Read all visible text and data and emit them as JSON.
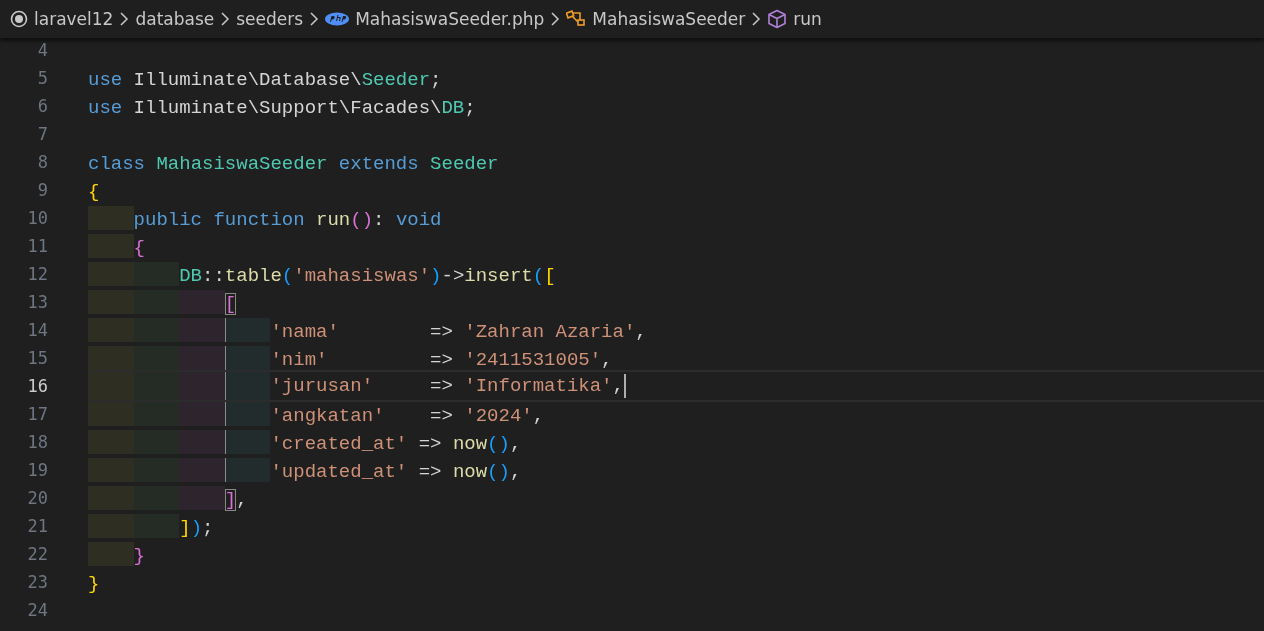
{
  "breadcrumb": [
    {
      "kind": "root",
      "label": "laravel12"
    },
    {
      "kind": "folder",
      "label": "database"
    },
    {
      "kind": "folder",
      "label": "seeders"
    },
    {
      "kind": "php_file",
      "label": "MahasiswaSeeder.php"
    },
    {
      "kind": "class",
      "label": "MahasiswaSeeder"
    },
    {
      "kind": "method",
      "label": "run"
    }
  ],
  "editor": {
    "lines": [
      {
        "number": "4",
        "current": false
      },
      {
        "number": "5",
        "current": false,
        "tokens": [
          {
            "kind": "keyword",
            "text": "use "
          },
          {
            "kind": "plain",
            "text": "Illuminate\\Database\\"
          },
          {
            "kind": "type",
            "text": "Seeder"
          },
          {
            "kind": "plain",
            "text": ";"
          }
        ]
      },
      {
        "number": "6",
        "current": false,
        "tokens": [
          {
            "kind": "keyword",
            "text": "use "
          },
          {
            "kind": "plain",
            "text": "Illuminate\\Support\\Facades\\"
          },
          {
            "kind": "type",
            "text": "DB"
          },
          {
            "kind": "plain",
            "text": ";"
          }
        ]
      },
      {
        "number": "7",
        "current": false
      },
      {
        "number": "8",
        "current": false,
        "tokens": [
          {
            "kind": "keyword",
            "text": "class "
          },
          {
            "kind": "type",
            "text": "MahasiswaSeeder "
          },
          {
            "kind": "keyword",
            "text": "extends "
          },
          {
            "kind": "type",
            "text": "Seeder"
          }
        ]
      },
      {
        "number": "9",
        "current": false,
        "tokens": [
          {
            "kind": "bracket1",
            "text": "{"
          }
        ]
      },
      {
        "number": "10",
        "current": false,
        "tokens": [
          {
            "kind": "keyword",
            "text": "    public function "
          },
          {
            "kind": "function",
            "text": "run"
          },
          {
            "kind": "bracket2",
            "text": "()"
          },
          {
            "kind": "plain",
            "text": ": "
          },
          {
            "kind": "keyword",
            "text": "void"
          }
        ]
      },
      {
        "number": "11",
        "current": false,
        "tokens": [
          {
            "kind": "bracket2",
            "text": "    {"
          }
        ]
      },
      {
        "number": "12",
        "current": false,
        "tokens": [
          {
            "kind": "type",
            "text": "        DB"
          },
          {
            "kind": "plain",
            "text": "::"
          },
          {
            "kind": "function",
            "text": "table"
          },
          {
            "kind": "bracket3",
            "text": "("
          },
          {
            "kind": "string",
            "text": "'mahasiswas'"
          },
          {
            "kind": "bracket3",
            "text": ")"
          },
          {
            "kind": "plain",
            "text": "->"
          },
          {
            "kind": "function",
            "text": "insert"
          },
          {
            "kind": "bracket3",
            "text": "("
          },
          {
            "kind": "bracket1",
            "text": "["
          }
        ]
      },
      {
        "number": "13",
        "current": false,
        "tokens": [
          {
            "kind": "bracket2",
            "text": "            [",
            "matched": true
          }
        ]
      },
      {
        "number": "14",
        "current": false,
        "bracket_guide": true,
        "tokens": [
          {
            "kind": "string",
            "text": "                'nama'"
          },
          {
            "kind": "plain",
            "text": "        => "
          },
          {
            "kind": "string",
            "text": "'Zahran Azaria'"
          },
          {
            "kind": "plain",
            "text": ","
          }
        ]
      },
      {
        "number": "15",
        "current": false,
        "bracket_guide": true,
        "tokens": [
          {
            "kind": "string",
            "text": "                'nim'"
          },
          {
            "kind": "plain",
            "text": "         => "
          },
          {
            "kind": "string",
            "text": "'2411531005'"
          },
          {
            "kind": "plain",
            "text": ","
          }
        ]
      },
      {
        "number": "16",
        "current": true,
        "bracket_guide": true,
        "tokens": [
          {
            "kind": "string",
            "text": "                'jurusan'"
          },
          {
            "kind": "plain",
            "text": "     => "
          },
          {
            "kind": "string",
            "text": "'Informatika'"
          },
          {
            "kind": "plain",
            "text": ","
          }
        ]
      },
      {
        "number": "17",
        "current": false,
        "bracket_guide": true,
        "tokens": [
          {
            "kind": "string",
            "text": "                'angkatan'"
          },
          {
            "kind": "plain",
            "text": "    => "
          },
          {
            "kind": "string",
            "text": "'2024'"
          },
          {
            "kind": "plain",
            "text": ","
          }
        ]
      },
      {
        "number": "18",
        "current": false,
        "bracket_guide": true,
        "tokens": [
          {
            "kind": "string",
            "text": "                'created_at'"
          },
          {
            "kind": "plain",
            "text": " => "
          },
          {
            "kind": "function",
            "text": "now"
          },
          {
            "kind": "bracket3",
            "text": "()"
          },
          {
            "kind": "plain",
            "text": ","
          }
        ]
      },
      {
        "number": "19",
        "current": false,
        "bracket_guide": true,
        "tokens": [
          {
            "kind": "string",
            "text": "                'updated_at'"
          },
          {
            "kind": "plain",
            "text": " => "
          },
          {
            "kind": "function",
            "text": "now"
          },
          {
            "kind": "bracket3",
            "text": "()"
          },
          {
            "kind": "plain",
            "text": ","
          }
        ]
      },
      {
        "number": "20",
        "current": false,
        "tokens": [
          {
            "kind": "bracket2",
            "text": "            ]",
            "matched": true
          },
          {
            "kind": "plain",
            "text": ","
          }
        ]
      },
      {
        "number": "21",
        "current": false,
        "tokens": [
          {
            "kind": "bracket1",
            "text": "        ]"
          },
          {
            "kind": "bracket3",
            "text": ")"
          },
          {
            "kind": "plain",
            "text": ";"
          }
        ]
      },
      {
        "number": "22",
        "current": false,
        "tokens": [
          {
            "kind": "bracket2",
            "text": "    }"
          }
        ]
      },
      {
        "number": "23",
        "current": false,
        "tokens": [
          {
            "kind": "bracket1",
            "text": "}"
          }
        ]
      },
      {
        "number": "24",
        "current": false
      }
    ]
  }
}
